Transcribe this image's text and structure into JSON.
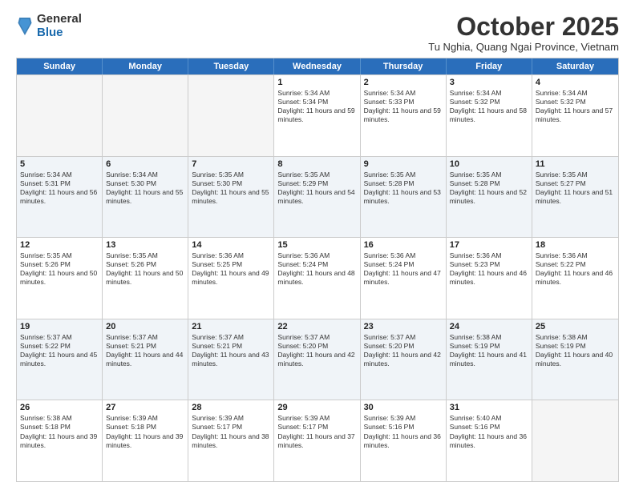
{
  "logo": {
    "general": "General",
    "blue": "Blue"
  },
  "title": "October 2025",
  "location": "Tu Nghia, Quang Ngai Province, Vietnam",
  "weekdays": [
    "Sunday",
    "Monday",
    "Tuesday",
    "Wednesday",
    "Thursday",
    "Friday",
    "Saturday"
  ],
  "weeks": [
    [
      {
        "day": "",
        "sunrise": "",
        "sunset": "",
        "daylight": "",
        "empty": true
      },
      {
        "day": "",
        "sunrise": "",
        "sunset": "",
        "daylight": "",
        "empty": true
      },
      {
        "day": "",
        "sunrise": "",
        "sunset": "",
        "daylight": "",
        "empty": true
      },
      {
        "day": "1",
        "sunrise": "Sunrise: 5:34 AM",
        "sunset": "Sunset: 5:34 PM",
        "daylight": "Daylight: 11 hours and 59 minutes."
      },
      {
        "day": "2",
        "sunrise": "Sunrise: 5:34 AM",
        "sunset": "Sunset: 5:33 PM",
        "daylight": "Daylight: 11 hours and 59 minutes."
      },
      {
        "day": "3",
        "sunrise": "Sunrise: 5:34 AM",
        "sunset": "Sunset: 5:32 PM",
        "daylight": "Daylight: 11 hours and 58 minutes."
      },
      {
        "day": "4",
        "sunrise": "Sunrise: 5:34 AM",
        "sunset": "Sunset: 5:32 PM",
        "daylight": "Daylight: 11 hours and 57 minutes."
      }
    ],
    [
      {
        "day": "5",
        "sunrise": "Sunrise: 5:34 AM",
        "sunset": "Sunset: 5:31 PM",
        "daylight": "Daylight: 11 hours and 56 minutes."
      },
      {
        "day": "6",
        "sunrise": "Sunrise: 5:34 AM",
        "sunset": "Sunset: 5:30 PM",
        "daylight": "Daylight: 11 hours and 55 minutes."
      },
      {
        "day": "7",
        "sunrise": "Sunrise: 5:35 AM",
        "sunset": "Sunset: 5:30 PM",
        "daylight": "Daylight: 11 hours and 55 minutes."
      },
      {
        "day": "8",
        "sunrise": "Sunrise: 5:35 AM",
        "sunset": "Sunset: 5:29 PM",
        "daylight": "Daylight: 11 hours and 54 minutes."
      },
      {
        "day": "9",
        "sunrise": "Sunrise: 5:35 AM",
        "sunset": "Sunset: 5:28 PM",
        "daylight": "Daylight: 11 hours and 53 minutes."
      },
      {
        "day": "10",
        "sunrise": "Sunrise: 5:35 AM",
        "sunset": "Sunset: 5:28 PM",
        "daylight": "Daylight: 11 hours and 52 minutes."
      },
      {
        "day": "11",
        "sunrise": "Sunrise: 5:35 AM",
        "sunset": "Sunset: 5:27 PM",
        "daylight": "Daylight: 11 hours and 51 minutes."
      }
    ],
    [
      {
        "day": "12",
        "sunrise": "Sunrise: 5:35 AM",
        "sunset": "Sunset: 5:26 PM",
        "daylight": "Daylight: 11 hours and 50 minutes."
      },
      {
        "day": "13",
        "sunrise": "Sunrise: 5:35 AM",
        "sunset": "Sunset: 5:26 PM",
        "daylight": "Daylight: 11 hours and 50 minutes."
      },
      {
        "day": "14",
        "sunrise": "Sunrise: 5:36 AM",
        "sunset": "Sunset: 5:25 PM",
        "daylight": "Daylight: 11 hours and 49 minutes."
      },
      {
        "day": "15",
        "sunrise": "Sunrise: 5:36 AM",
        "sunset": "Sunset: 5:24 PM",
        "daylight": "Daylight: 11 hours and 48 minutes."
      },
      {
        "day": "16",
        "sunrise": "Sunrise: 5:36 AM",
        "sunset": "Sunset: 5:24 PM",
        "daylight": "Daylight: 11 hours and 47 minutes."
      },
      {
        "day": "17",
        "sunrise": "Sunrise: 5:36 AM",
        "sunset": "Sunset: 5:23 PM",
        "daylight": "Daylight: 11 hours and 46 minutes."
      },
      {
        "day": "18",
        "sunrise": "Sunrise: 5:36 AM",
        "sunset": "Sunset: 5:22 PM",
        "daylight": "Daylight: 11 hours and 46 minutes."
      }
    ],
    [
      {
        "day": "19",
        "sunrise": "Sunrise: 5:37 AM",
        "sunset": "Sunset: 5:22 PM",
        "daylight": "Daylight: 11 hours and 45 minutes."
      },
      {
        "day": "20",
        "sunrise": "Sunrise: 5:37 AM",
        "sunset": "Sunset: 5:21 PM",
        "daylight": "Daylight: 11 hours and 44 minutes."
      },
      {
        "day": "21",
        "sunrise": "Sunrise: 5:37 AM",
        "sunset": "Sunset: 5:21 PM",
        "daylight": "Daylight: 11 hours and 43 minutes."
      },
      {
        "day": "22",
        "sunrise": "Sunrise: 5:37 AM",
        "sunset": "Sunset: 5:20 PM",
        "daylight": "Daylight: 11 hours and 42 minutes."
      },
      {
        "day": "23",
        "sunrise": "Sunrise: 5:37 AM",
        "sunset": "Sunset: 5:20 PM",
        "daylight": "Daylight: 11 hours and 42 minutes."
      },
      {
        "day": "24",
        "sunrise": "Sunrise: 5:38 AM",
        "sunset": "Sunset: 5:19 PM",
        "daylight": "Daylight: 11 hours and 41 minutes."
      },
      {
        "day": "25",
        "sunrise": "Sunrise: 5:38 AM",
        "sunset": "Sunset: 5:19 PM",
        "daylight": "Daylight: 11 hours and 40 minutes."
      }
    ],
    [
      {
        "day": "26",
        "sunrise": "Sunrise: 5:38 AM",
        "sunset": "Sunset: 5:18 PM",
        "daylight": "Daylight: 11 hours and 39 minutes."
      },
      {
        "day": "27",
        "sunrise": "Sunrise: 5:39 AM",
        "sunset": "Sunset: 5:18 PM",
        "daylight": "Daylight: 11 hours and 39 minutes."
      },
      {
        "day": "28",
        "sunrise": "Sunrise: 5:39 AM",
        "sunset": "Sunset: 5:17 PM",
        "daylight": "Daylight: 11 hours and 38 minutes."
      },
      {
        "day": "29",
        "sunrise": "Sunrise: 5:39 AM",
        "sunset": "Sunset: 5:17 PM",
        "daylight": "Daylight: 11 hours and 37 minutes."
      },
      {
        "day": "30",
        "sunrise": "Sunrise: 5:39 AM",
        "sunset": "Sunset: 5:16 PM",
        "daylight": "Daylight: 11 hours and 36 minutes."
      },
      {
        "day": "31",
        "sunrise": "Sunrise: 5:40 AM",
        "sunset": "Sunset: 5:16 PM",
        "daylight": "Daylight: 11 hours and 36 minutes."
      },
      {
        "day": "",
        "sunrise": "",
        "sunset": "",
        "daylight": "",
        "empty": true
      }
    ]
  ]
}
